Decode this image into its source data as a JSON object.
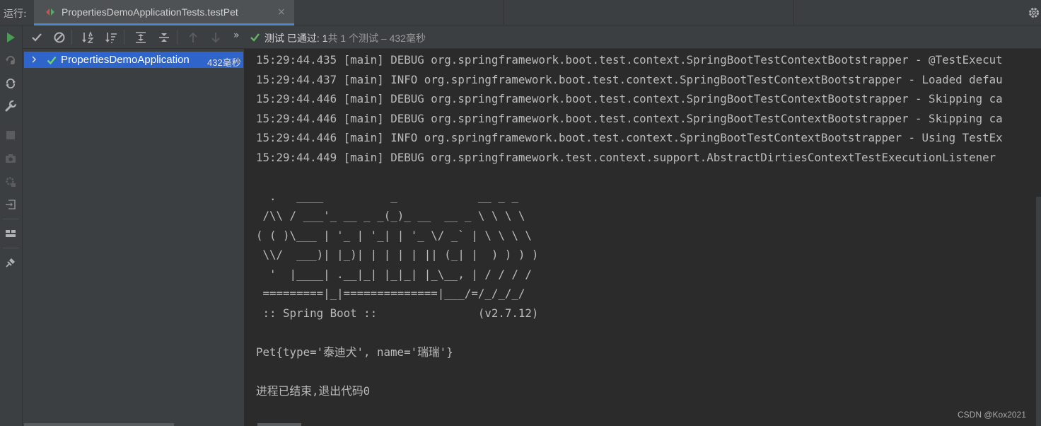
{
  "run_label": "运行:",
  "tab": {
    "title": "PropertiesDemoApplicationTests.testPet",
    "close": "×"
  },
  "toolbar": {
    "status_prefix": "测试 已通过: ",
    "status_count": "1",
    "status_suffix": "共 1 个测试 – 432毫秒",
    "more": "»"
  },
  "tree": {
    "items": [
      {
        "label": "PropertiesDemoApplication",
        "time": "432毫秒",
        "status": "passed"
      }
    ]
  },
  "console": {
    "lines": [
      "15:29:44.435 [main] DEBUG org.springframework.boot.test.context.SpringBootTestContextBootstrapper - @TestExecut",
      "15:29:44.437 [main] INFO org.springframework.boot.test.context.SpringBootTestContextBootstrapper - Loaded defau",
      "15:29:44.446 [main] DEBUG org.springframework.boot.test.context.SpringBootTestContextBootstrapper - Skipping ca",
      "15:29:44.446 [main] DEBUG org.springframework.boot.test.context.SpringBootTestContextBootstrapper - Skipping ca",
      "15:29:44.446 [main] INFO org.springframework.boot.test.context.SpringBootTestContextBootstrapper - Using TestEx",
      "15:29:44.449 [main] DEBUG org.springframework.test.context.support.AbstractDirtiesContextTestExecutionListener "
    ],
    "banner": [
      "  .   ____          _            __ _ _",
      " /\\\\ / ___'_ __ _ _(_)_ __  __ _ \\ \\ \\ \\",
      "( ( )\\___ | '_ | '_| | '_ \\/ _` | \\ \\ \\ \\",
      " \\\\/  ___)| |_)| | | | | || (_| |  ) ) ) )",
      "  '  |____| .__|_| |_|_| |_\\__, | / / / /",
      " =========|_|==============|___/=/_/_/_/",
      " :: Spring Boot ::               (v2.7.12)"
    ],
    "output": "Pet{type='泰迪犬', name='瑞瑞'}",
    "exit": "进程已结束,退出代码0"
  },
  "watermark": "CSDN @Kox2021",
  "colors": {
    "background": "#2b2b2b",
    "panel": "#3c3f41",
    "selection": "#2f65ca",
    "pass_green": "#5fb85f",
    "run_green": "#499c54",
    "tab_underline": "#4a88c7"
  },
  "icons": {
    "left_bar": [
      "run-icon",
      "rerun-failed-icon",
      "toggle-auto-test-icon",
      "settings-wrench-icon",
      "stop-icon",
      "camera-icon",
      "debug-gear-icon",
      "exit-icon",
      "layout-icon",
      "pin-icon"
    ],
    "toolbar": [
      "show-passed-icon",
      "show-ignored-icon",
      "sort-alpha-icon",
      "sort-duration-icon",
      "expand-all-icon",
      "collapse-all-icon",
      "previous-icon",
      "next-icon"
    ]
  }
}
